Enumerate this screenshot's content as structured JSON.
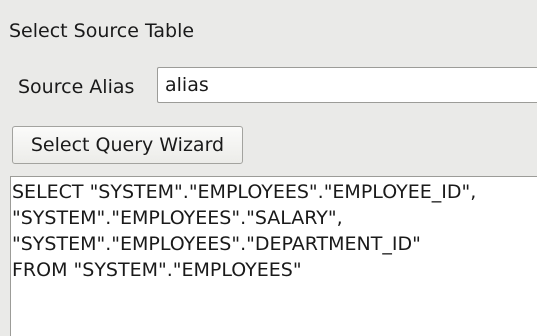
{
  "section": {
    "title": "Select Source Table"
  },
  "alias": {
    "label": "Source Alias",
    "value": "alias"
  },
  "wizard": {
    "button_label": "Select Query Wizard"
  },
  "query": {
    "lines": [
      "SELECT \"SYSTEM\".\"EMPLOYEES\".\"EMPLOYEE_ID\",",
      "\"SYSTEM\".\"EMPLOYEES\".\"SALARY\",",
      "\"SYSTEM\".\"EMPLOYEES\".\"DEPARTMENT_ID\"",
      "FROM \"SYSTEM\".\"EMPLOYEES\""
    ]
  }
}
